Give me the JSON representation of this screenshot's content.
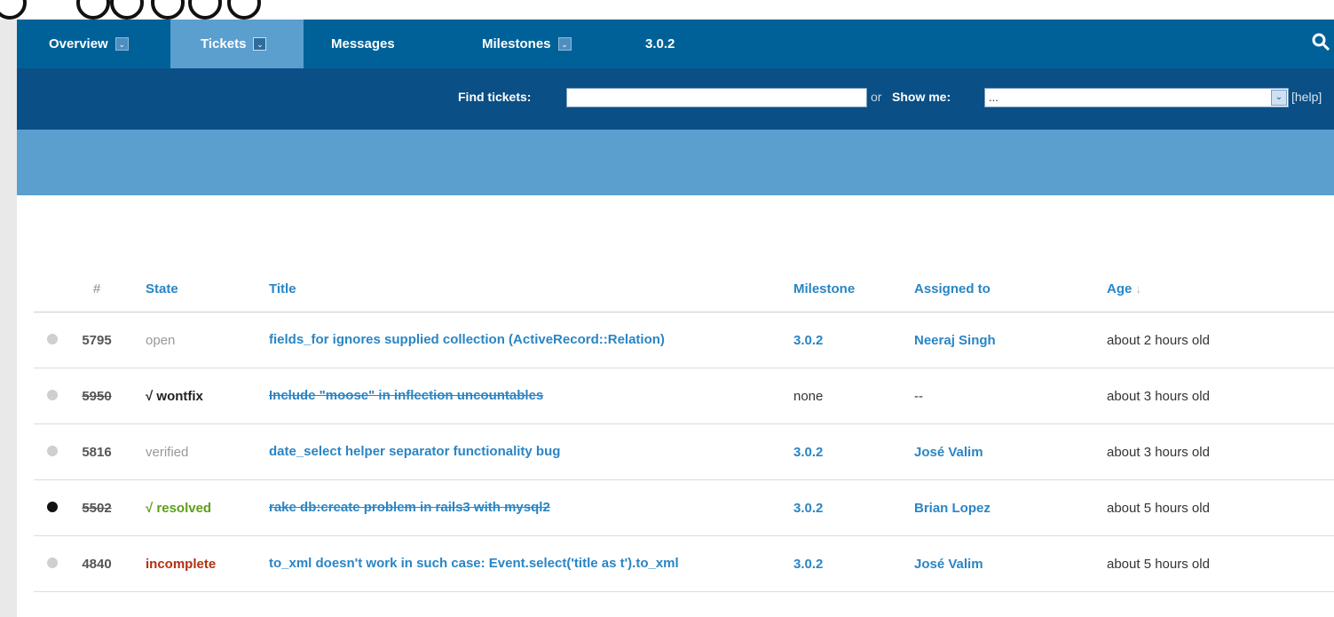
{
  "nav": {
    "overview": "Overview",
    "tickets": "Tickets",
    "messages": "Messages",
    "milestones": "Milestones",
    "version": "3.0.2",
    "caret": "⌄",
    "search_icon": "search-icon"
  },
  "find": {
    "label": "Find tickets:",
    "input_value": "",
    "or_text": "or",
    "show_label": "Show me:",
    "select_value": "...",
    "select_arrow": "⌄",
    "help": "[help]"
  },
  "columns": {
    "num": "#",
    "state": "State",
    "title": "Title",
    "milestone": "Milestone",
    "assigned": "Assigned to",
    "age": "Age",
    "age_sort": "↓"
  },
  "tickets": [
    {
      "number": "5795",
      "state": "open",
      "title": "fields_for ignores supplied collection (ActiveRecord::Relation)",
      "milestone": "3.0.2",
      "assigned": "Neeraj Singh",
      "age": "about 2 hours old"
    },
    {
      "number": "5950",
      "state": "√ wontfix",
      "title": "Include \"moose\" in inflection uncountables",
      "milestone": "none",
      "assigned": "--",
      "age": "about 3 hours old"
    },
    {
      "number": "5816",
      "state": "verified",
      "title": "date_select helper separator functionality bug",
      "milestone": "3.0.2",
      "assigned": "José Valim",
      "age": "about 3 hours old"
    },
    {
      "number": "5502",
      "state": "√ resolved",
      "title": "rake db:create problem in rails3 with mysql2",
      "milestone": "3.0.2",
      "assigned": "Brian Lopez",
      "age": "about 5 hours old"
    },
    {
      "number": "4840",
      "state": "incomplete",
      "title": "to_xml doesn't work in such case: Event.select('title as t').to_xml",
      "milestone": "3.0.2",
      "assigned": "José Valim",
      "age": "about 5 hours old"
    }
  ],
  "colors": {
    "nav_bg": "#006198",
    "findbar_bg": "#0a4f85",
    "light_band": "#5b9fcf",
    "link": "#2a85c4",
    "resolved": "#5c9f1b",
    "incomplete": "#b3300f"
  }
}
